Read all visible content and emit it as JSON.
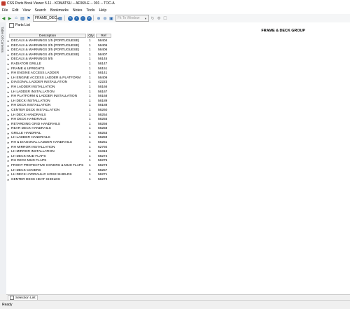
{
  "window": {
    "title": "CSS Parts Book Viewer 5.11 - KOMATSU -- AF069-E -- 001 -- TOC-A"
  },
  "menu": [
    "File",
    "Edit",
    "View",
    "Search",
    "Bookmarks",
    "Notes",
    "Tools",
    "Help"
  ],
  "toolbar": {
    "combo_value": "FRAME_DEC",
    "fit_combo": "Fit To Window"
  },
  "sidebar": {
    "tab_label": "Table Of Contents"
  },
  "panel": {
    "title": "Parts List"
  },
  "group_title": "FRAME & DECK GROUP",
  "table": {
    "headers": {
      "description": "Description",
      "qty": "Qty",
      "ref": "Ref"
    },
    "rows": [
      {
        "description": "DECALS & WARNINGS  1/5  (PORTUGUESE)",
        "qty": "1",
        "ref": "56404"
      },
      {
        "description": "DECALS & WARNINGS  2/5  (PORTUGUESE)",
        "qty": "1",
        "ref": "56405"
      },
      {
        "description": "DECALS & WARNINGS  3/5  (PORTUGUESE)",
        "qty": "1",
        "ref": "56406"
      },
      {
        "description": "DECALS & WARNINGS  4/5  (PORTUGUESE)",
        "qty": "1",
        "ref": "56407"
      },
      {
        "description": "DECALS & WARNINGS  5/5",
        "qty": "1",
        "ref": "56145"
      },
      {
        "description": "RADIATOR GRILLE",
        "qty": "1",
        "ref": "56147"
      },
      {
        "description": "FRAME & UPRIGHTS",
        "qty": "1",
        "ref": "56151"
      },
      {
        "description": "RH ENGINE ACCESS LADDER",
        "qty": "1",
        "ref": "56141"
      },
      {
        "description": "LH ENGINE ACCESS LADDER & PLATFORM",
        "qty": "1",
        "ref": "56409"
      },
      {
        "description": "DIAGONAL LADDER INSTALLATION",
        "qty": "1",
        "ref": "42223"
      },
      {
        "description": "RH LADDER INSTALLATION",
        "qty": "1",
        "ref": "56166"
      },
      {
        "description": "LH LADDER INSTALLATION",
        "qty": "1",
        "ref": "56167"
      },
      {
        "description": "RH PLATFORM & LADDER INSTALLATION",
        "qty": "1",
        "ref": "56168"
      },
      {
        "description": "LH DECK INSTALLATION",
        "qty": "1",
        "ref": "56189"
      },
      {
        "description": "RH DECK INSTALLATION",
        "qty": "1",
        "ref": "56188"
      },
      {
        "description": "CENTER DECK INSTALLATION",
        "qty": "1",
        "ref": "56260"
      },
      {
        "description": "LH DECK HANDRAILS",
        "qty": "1",
        "ref": "56254"
      },
      {
        "description": "RH DECK HANDRAILS",
        "qty": "1",
        "ref": "56255"
      },
      {
        "description": "RETARDING GRID HANDRAILS",
        "qty": "1",
        "ref": "56256"
      },
      {
        "description": "REAR DECK HANDRAILS",
        "qty": "1",
        "ref": "56258"
      },
      {
        "description": "GRILLE HANDRAIL",
        "qty": "1",
        "ref": "56253"
      },
      {
        "description": "LH LADDER HANDRAILS",
        "qty": "1",
        "ref": "56259"
      },
      {
        "description": "RH & DIAGONAL LADDER HANDRAILS",
        "qty": "1",
        "ref": "56251"
      },
      {
        "description": "RH MIRROR INSTALLATION",
        "qty": "1",
        "ref": "62792"
      },
      {
        "description": "LH MIRROR INSTALLATION",
        "qty": "1",
        "ref": "61816"
      },
      {
        "description": "LH DECK MUD FLAPS",
        "qty": "1",
        "ref": "56274"
      },
      {
        "description": "RH DECK MUD FLAPS",
        "qty": "1",
        "ref": "56275"
      },
      {
        "description": "FRONT PROTECTIVE COVERS & MUD FLAPS",
        "qty": "1",
        "ref": "56273"
      },
      {
        "description": "LH DECK COVERS",
        "qty": "1",
        "ref": "56257"
      },
      {
        "description": "LH DECK HYDRAULIC HOSE SHIELDS",
        "qty": "1",
        "ref": "56271"
      },
      {
        "description": "CENTER DECK HEAT SHIELDS",
        "qty": "1",
        "ref": "56272"
      }
    ]
  },
  "bottom_tab": {
    "label": "Selection List"
  },
  "status": {
    "text": "Ready"
  }
}
